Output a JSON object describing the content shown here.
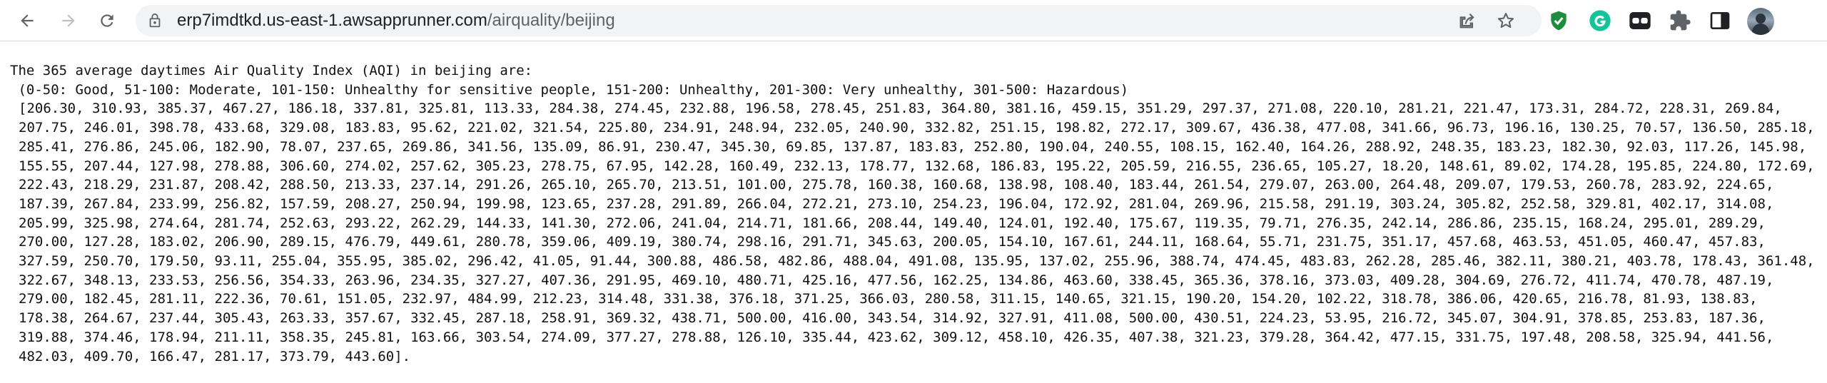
{
  "browser": {
    "url_host": "erp7imdtkd.us-east-1.awsapprunner.com",
    "url_path": "/airquality/beijing",
    "icons": {
      "back": "back-arrow-icon",
      "forward": "forward-arrow-icon",
      "reload": "reload-icon",
      "lock": "lock-icon",
      "share": "share-icon",
      "bookmark": "star-icon",
      "ext1": "shield-check-icon",
      "ext2": "grammarly-icon",
      "ext3": "glasses-icon",
      "extensions": "puzzle-icon",
      "sidepanel": "side-panel-icon",
      "profile": "avatar"
    },
    "colors": {
      "shield": "#1e8e3e",
      "grammarly": "#15c39a",
      "glasses": "#202124"
    }
  },
  "page": {
    "heading": "The 365 average daytimes Air Quality Index (AQI) in beijing are:",
    "legend": " (0-50: Good, 51-100: Moderate, 101-150: Unhealthy for sensitive people, 151-200: Unhealthy, 201-300: Very unhealthy, 301-500: Hazardous)",
    "values_text": "[206.30, 310.93, 385.37, 467.27, 186.18, 337.81, 325.81, 113.33, 284.38, 274.45, 232.88, 196.58, 278.45, 251.83, 364.80, 381.16, 459.15, 351.29, 297.37, 271.08, 220.10, 281.21, 221.47, 173.31, 284.72, 228.31, 269.84, 207.75, 246.01, 398.78, 433.68, 329.08, 183.83, 95.62, 221.02, 321.54, 225.80, 234.91, 248.94, 232.05, 240.90, 332.82, 251.15, 198.82, 272.17, 309.67, 436.38, 477.08, 341.66, 96.73, 196.16, 130.25, 70.57, 136.50, 285.18, 285.41, 276.86, 245.06, 182.90, 78.07, 237.65, 269.86, 341.56, 135.09, 86.91, 230.47, 345.30, 69.85, 137.87, 183.83, 252.80, 190.04, 240.55, 108.15, 162.40, 164.26, 288.92, 248.35, 183.23, 182.30, 92.03, 117.26, 145.98, 155.55, 207.44, 127.98, 278.88, 306.60, 274.02, 257.62, 305.23, 278.75, 67.95, 142.28, 160.49, 232.13, 178.77, 132.68, 186.83, 195.22, 205.59, 216.55, 236.65, 105.27, 18.20, 148.61, 89.02, 174.28, 195.85, 224.80, 172.69, 222.43, 218.29, 231.87, 208.42, 288.50, 213.33, 237.14, 291.26, 265.10, 265.70, 213.51, 101.00, 275.78, 160.38, 160.68, 138.98, 108.40, 183.44, 261.54, 279.07, 263.00, 264.48, 209.07, 179.53, 260.78, 283.92, 224.65, 187.39, 267.84, 233.99, 256.82, 157.59, 208.27, 250.94, 199.98, 123.65, 237.28, 291.89, 266.04, 272.21, 273.10, 254.23, 196.04, 172.92, 281.04, 269.96, 215.58, 291.19, 303.24, 305.82, 252.58, 329.81, 402.17, 314.08, 205.99, 325.98, 274.64, 281.74, 252.63, 293.22, 262.29, 144.33, 141.30, 272.06, 241.04, 214.71, 181.66, 208.44, 149.40, 124.01, 192.40, 175.67, 119.35, 79.71, 276.35, 242.14, 286.86, 235.15, 168.24, 295.01, 289.29, 270.00, 127.28, 183.02, 206.90, 289.15, 476.79, 449.61, 280.78, 359.06, 409.19, 380.74, 298.16, 291.71, 345.63, 200.05, 154.10, 167.61, 244.11, 168.64, 55.71, 231.75, 351.17, 457.68, 463.53, 451.05, 460.47, 457.83, 327.59, 250.70, 179.50, 93.11, 255.04, 355.95, 385.02, 296.42, 41.05, 91.44, 300.88, 486.58, 482.86, 488.04, 491.08, 135.95, 137.02, 255.96, 388.74, 474.45, 483.83, 262.28, 285.46, 382.11, 380.21, 403.78, 178.43, 361.48, 322.67, 348.13, 233.53, 256.56, 354.33, 263.96, 234.35, 327.27, 407.36, 291.95, 469.10, 480.71, 425.16, 477.56, 162.25, 134.86, 463.60, 338.45, 365.36, 378.16, 373.03, 409.28, 304.69, 276.72, 411.74, 470.78, 487.19, 279.00, 182.45, 281.11, 222.36, 70.61, 151.05, 232.97, 484.99, 212.23, 314.48, 331.38, 376.18, 371.25, 366.03, 280.58, 311.15, 140.65, 321.15, 190.20, 154.20, 102.22, 318.78, 386.06, 420.65, 216.78, 81.93, 138.83, 178.38, 264.67, 237.44, 305.43, 263.33, 357.67, 332.45, 287.18, 258.91, 369.32, 438.71, 500.00, 416.00, 343.54, 314.92, 327.91, 411.08, 500.00, 430.51, 224.23, 53.95, 216.72, 345.07, 304.91, 378.85, 253.83, 187.36, 319.88, 374.46, 178.94, 211.11, 358.35, 245.81, 163.66, 303.54, 274.09, 377.27, 278.88, 126.10, 335.44, 423.62, 309.12, 458.10, 426.35, 407.38, 321.23, 379.28, 364.42, 477.15, 331.75, 197.48, 208.58, 325.94, 441.56, 482.03, 409.70, 166.47, 281.17, 373.79, 443.60]."
  }
}
